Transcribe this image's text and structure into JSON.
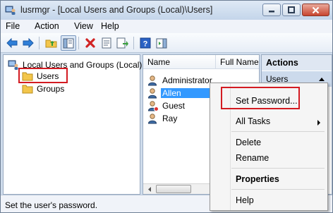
{
  "window": {
    "title": "lusrmgr - [Local Users and Groups (Local)\\Users]"
  },
  "menubar": [
    "File",
    "Action",
    "View",
    "Help"
  ],
  "toolbar": {
    "icons": [
      "back-icon",
      "forward-icon",
      "up-folder-icon",
      "show-hide-tree-icon",
      "delete-icon",
      "properties-icon",
      "export-list-icon",
      "help-icon",
      "show-hide-action-pane-icon"
    ]
  },
  "tree": {
    "root": "Local Users and Groups (Local)",
    "items": [
      "Users",
      "Groups"
    ]
  },
  "list": {
    "columns": [
      "Name",
      "Full Name"
    ],
    "rows": [
      "Administrator",
      "Allen",
      "Guest",
      "Ray"
    ],
    "selected": "Allen"
  },
  "actions": {
    "header": "Actions",
    "subheader": "Users"
  },
  "context_menu": {
    "items": [
      "Set Password...",
      "All Tasks",
      "Delete",
      "Rename",
      "Properties",
      "Help"
    ]
  },
  "status": "Set the user's password.",
  "colors": {
    "highlight": "#d31b22",
    "selection": "#3399ff"
  }
}
